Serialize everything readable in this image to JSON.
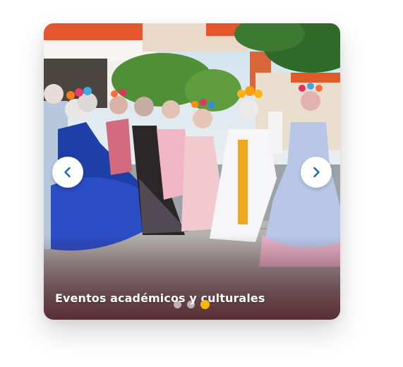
{
  "carousel": {
    "caption": "Eventos académicos y culturales",
    "photo_description": "Grupo de jóvenes caracterizadas como catrinas",
    "prev_icon": "chevron-left-icon",
    "next_icon": "chevron-right-icon",
    "slide_count": 3,
    "active_slide": 3,
    "colors": {
      "arrow": "#1565c0",
      "dot_active": "#f5b800",
      "dot_inactive": "#ffffff"
    }
  }
}
